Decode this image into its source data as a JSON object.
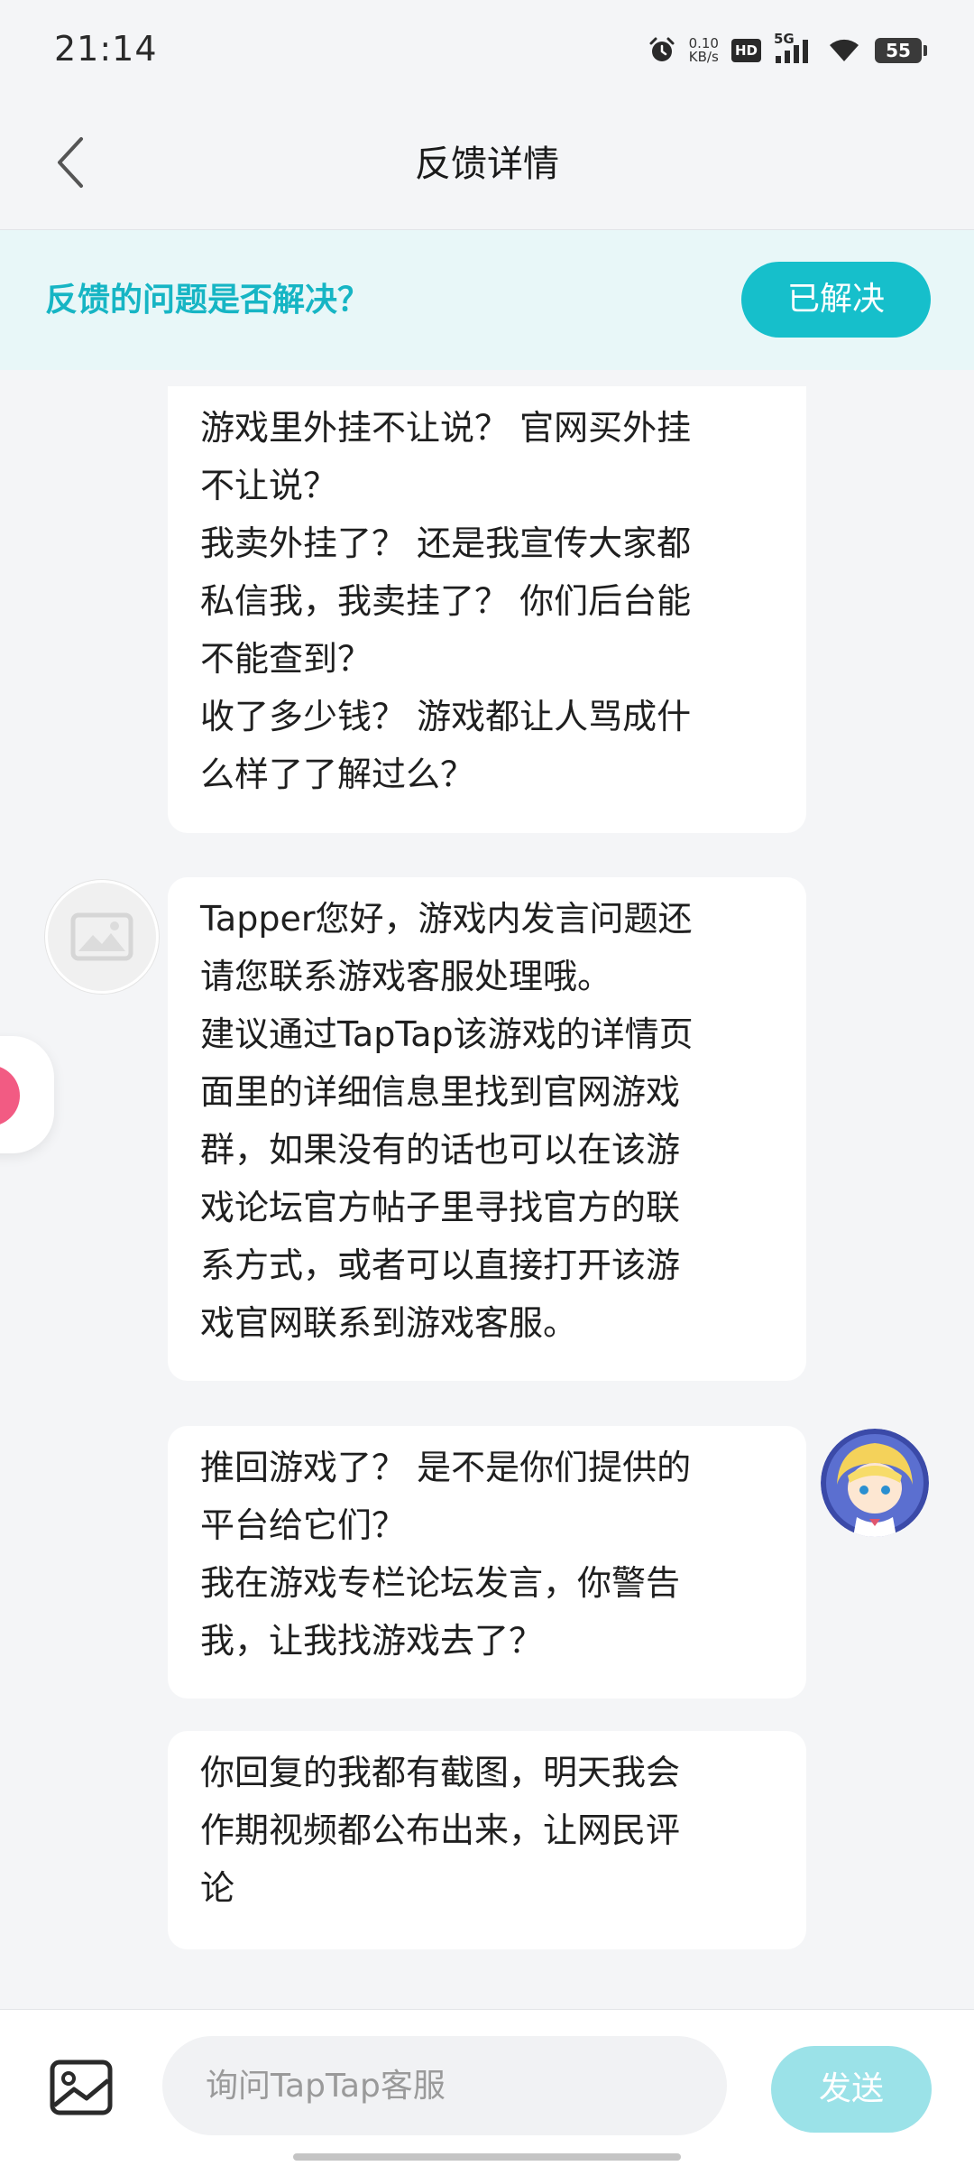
{
  "status_bar": {
    "time": "21:14",
    "net_speed_value": "0.10",
    "net_speed_unit": "KB/s",
    "hd_label": "HD",
    "network_label": "5G",
    "battery": "55",
    "icons": [
      "alarm-icon",
      "hd-icon",
      "5g-signal-icon",
      "wifi-icon",
      "battery-icon"
    ]
  },
  "header": {
    "title": "反馈详情",
    "back_icon": "chevron-left-icon"
  },
  "resolve_banner": {
    "question": "反馈的问题是否解决？",
    "button_label": "已解决",
    "accent_color": "#16b5c4"
  },
  "messages": [
    {
      "sender": "user",
      "lines": [
        "游戏里外挂不让说？ 官网买外挂",
        "不让说？",
        "我卖外挂了？ 还是我宣传大家都",
        "私信我，我卖挂了？ 你们后台能",
        "不能查到？",
        "收了多少钱？ 游戏都让人骂成什",
        "么样了了解过么？"
      ]
    },
    {
      "sender": "support",
      "lines": [
        "Tapper您好，游戏内发言问题还",
        "请您联系游戏客服处理哦。",
        "建议通过TapTap该游戏的详情页",
        "面里的详细信息里找到官网游戏",
        "群，如果没有的话也可以在该游",
        "戏论坛官方帖子里寻找官方的联",
        "系方式，或者可以直接打开该游",
        "戏官网联系到游戏客服。"
      ]
    },
    {
      "sender": "user",
      "lines": [
        "推回游戏了？ 是不是你们提供的",
        "平台给它们？",
        "我在游戏专栏论坛发言，你警告",
        "我，让我找游戏去了？"
      ]
    },
    {
      "sender": "user",
      "lines": [
        "你回复的我都有截图，明天我会",
        "作期视频都公布出来，让网民评",
        "论"
      ]
    }
  ],
  "input_bar": {
    "image_icon": "image-picker-icon",
    "placeholder": "询问TapTap客服",
    "value": "",
    "send_label": "发送"
  },
  "colors": {
    "background": "#f4f5f7",
    "accent": "#16bfcb",
    "send_disabled": "#9be2e8",
    "banner_bg": "#e8f7f8"
  }
}
